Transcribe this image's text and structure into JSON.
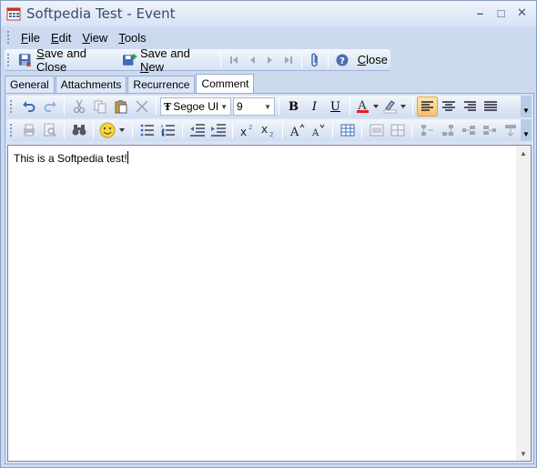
{
  "window": {
    "title": "Softpedia Test - Event",
    "controls": {
      "minimize": "–",
      "maximize": "□",
      "close": "✕"
    }
  },
  "menu": {
    "items": [
      {
        "accel": "F",
        "rest": "ile"
      },
      {
        "accel": "E",
        "rest": "dit"
      },
      {
        "accel": "V",
        "rest": "iew"
      },
      {
        "accel": "T",
        "rest": "ools"
      }
    ]
  },
  "toolbar": {
    "save_close": {
      "accel": "S",
      "rest": "ave and Close"
    },
    "save_new": {
      "pre": "Save and ",
      "accel": "N",
      "rest": "ew"
    },
    "close": {
      "accel": "C",
      "rest": "lose"
    }
  },
  "tabs": [
    "General",
    "Attachments",
    "Recurrence",
    "Comment"
  ],
  "active_tab": "Comment",
  "format": {
    "font_name": "Segoe UI",
    "font_size": "9",
    "bold": "B",
    "italic": "I",
    "underline": "U"
  },
  "editor": {
    "text": "This is a Softpedia test!"
  },
  "colors": {
    "accent": "#ccdaf0",
    "active_button": "#f6c069"
  }
}
